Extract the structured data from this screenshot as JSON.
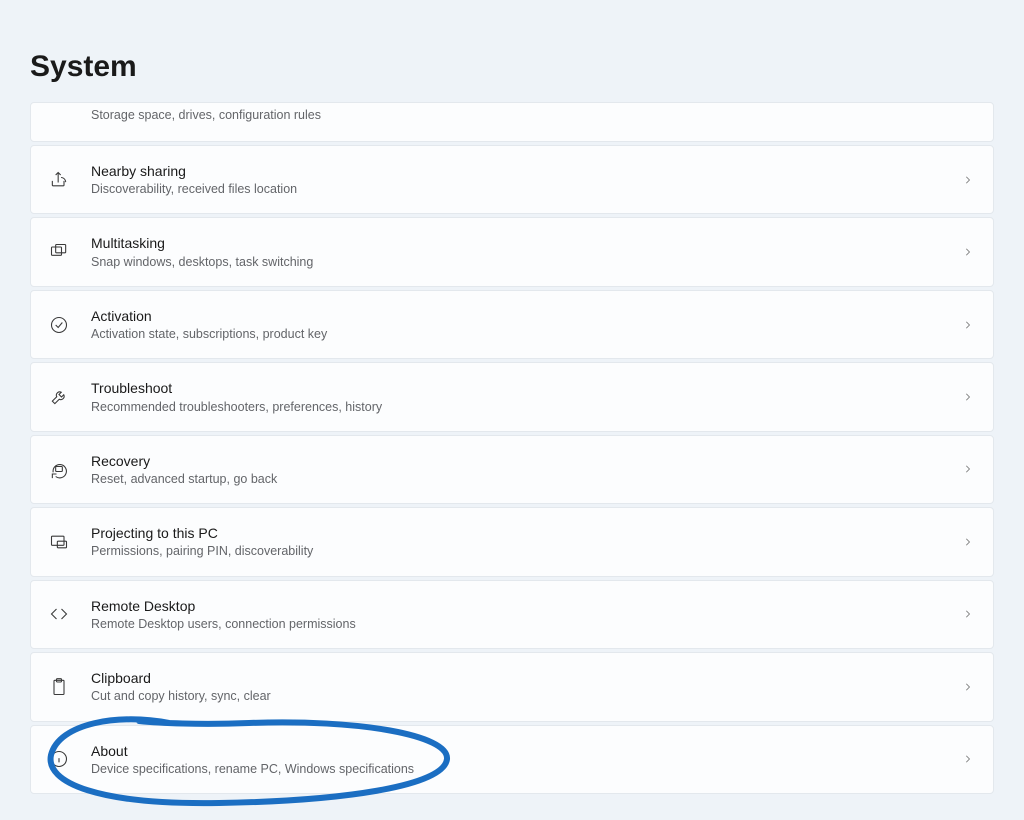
{
  "page_title": "System",
  "items": [
    {
      "id": "storage-partial",
      "title": "",
      "subtitle": "Storage space, drives, configuration rules",
      "icon": "none",
      "partial": true
    },
    {
      "id": "nearby-sharing",
      "title": "Nearby sharing",
      "subtitle": "Discoverability, received files location",
      "icon": "share"
    },
    {
      "id": "multitasking",
      "title": "Multitasking",
      "subtitle": "Snap windows, desktops, task switching",
      "icon": "windows"
    },
    {
      "id": "activation",
      "title": "Activation",
      "subtitle": "Activation state, subscriptions, product key",
      "icon": "check-circle"
    },
    {
      "id": "troubleshoot",
      "title": "Troubleshoot",
      "subtitle": "Recommended troubleshooters, preferences, history",
      "icon": "wrench"
    },
    {
      "id": "recovery",
      "title": "Recovery",
      "subtitle": "Reset, advanced startup, go back",
      "icon": "recovery"
    },
    {
      "id": "projecting",
      "title": "Projecting to this PC",
      "subtitle": "Permissions, pairing PIN, discoverability",
      "icon": "project"
    },
    {
      "id": "remote-desktop",
      "title": "Remote Desktop",
      "subtitle": "Remote Desktop users, connection permissions",
      "icon": "remote"
    },
    {
      "id": "clipboard",
      "title": "Clipboard",
      "subtitle": "Cut and copy history, sync, clear",
      "icon": "clipboard"
    },
    {
      "id": "about",
      "title": "About",
      "subtitle": "Device specifications, rename PC, Windows specifications",
      "icon": "info",
      "annotated": true
    }
  ],
  "annotation_color": "#1b6ec2"
}
